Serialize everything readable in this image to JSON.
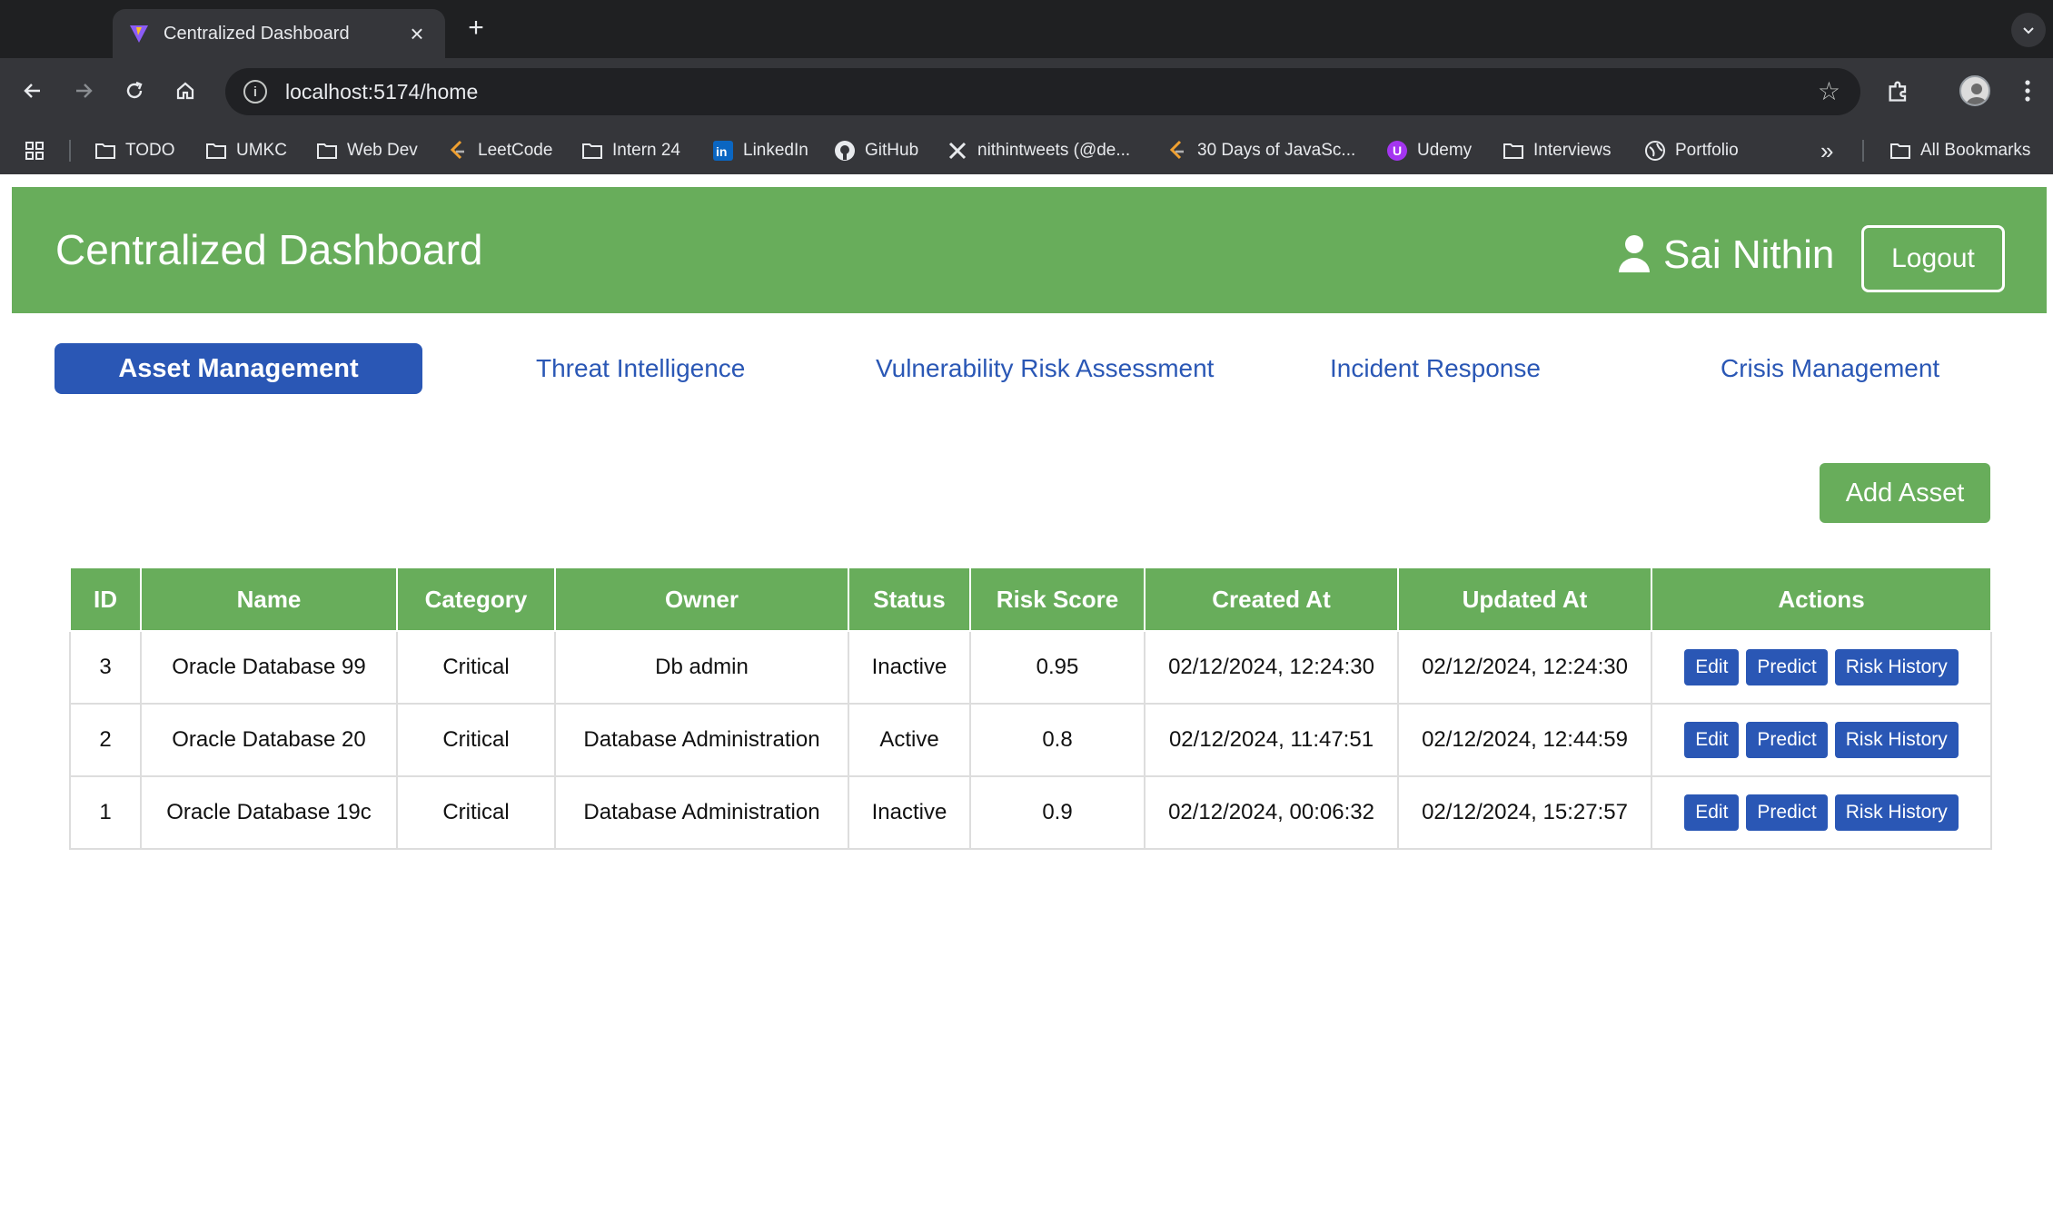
{
  "browser": {
    "tab_title": "Centralized Dashboard",
    "new_tab_symbol": "+",
    "close_symbol": "×",
    "url": "localhost:5174/home",
    "bookmarks": [
      {
        "label": "TODO",
        "icon": "folder-icon"
      },
      {
        "label": "UMKC",
        "icon": "folder-icon"
      },
      {
        "label": "Web Dev",
        "icon": "folder-icon"
      },
      {
        "label": "LeetCode",
        "icon": "leetcode-icon"
      },
      {
        "label": "Intern 24",
        "icon": "folder-icon"
      },
      {
        "label": "LinkedIn",
        "icon": "linkedin-icon"
      },
      {
        "label": "GitHub",
        "icon": "github-icon"
      },
      {
        "label": "nithintweets (@de...",
        "icon": "x-icon"
      },
      {
        "label": "30 Days of JavaSc...",
        "icon": "leetcode-icon"
      },
      {
        "label": "Udemy",
        "icon": "udemy-icon"
      },
      {
        "label": "Interviews",
        "icon": "folder-icon"
      },
      {
        "label": "Portfolio",
        "icon": "globe-icon"
      }
    ],
    "more_symbol": "»",
    "all_bookmarks": "All Bookmarks"
  },
  "app": {
    "title": "Centralized Dashboard",
    "user_name": "Sai Nithin",
    "logout_label": "Logout",
    "nav_tabs": [
      {
        "label": "Asset Management",
        "active": true
      },
      {
        "label": "Threat Intelligence",
        "active": false
      },
      {
        "label": "Vulnerability Risk Assessment",
        "active": false
      },
      {
        "label": "Incident Response",
        "active": false
      },
      {
        "label": "Crisis Management",
        "active": false
      }
    ],
    "add_asset_label": "Add Asset",
    "table": {
      "headers": [
        "ID",
        "Name",
        "Category",
        "Owner",
        "Status",
        "Risk Score",
        "Created At",
        "Updated At",
        "Actions"
      ],
      "rows": [
        {
          "id": "3",
          "name": "Oracle Database 99",
          "category": "Critical",
          "owner": "Db admin",
          "status": "Inactive",
          "risk_score": "0.95",
          "created_at": "02/12/2024, 12:24:30",
          "updated_at": "02/12/2024, 12:24:30"
        },
        {
          "id": "2",
          "name": "Oracle Database 20",
          "category": "Critical",
          "owner": "Database Administration",
          "status": "Active",
          "risk_score": "0.8",
          "created_at": "02/12/2024, 11:47:51",
          "updated_at": "02/12/2024, 12:44:59"
        },
        {
          "id": "1",
          "name": "Oracle Database 19c",
          "category": "Critical",
          "owner": "Database Administration",
          "status": "Inactive",
          "risk_score": "0.9",
          "created_at": "02/12/2024, 00:06:32",
          "updated_at": "02/12/2024, 15:27:57"
        }
      ],
      "action_labels": {
        "edit": "Edit",
        "predict": "Predict",
        "risk_history": "Risk History"
      }
    }
  },
  "colors": {
    "header_green": "#68ad5b",
    "accent_blue": "#2a57b5",
    "chrome_dark": "#35363a"
  }
}
